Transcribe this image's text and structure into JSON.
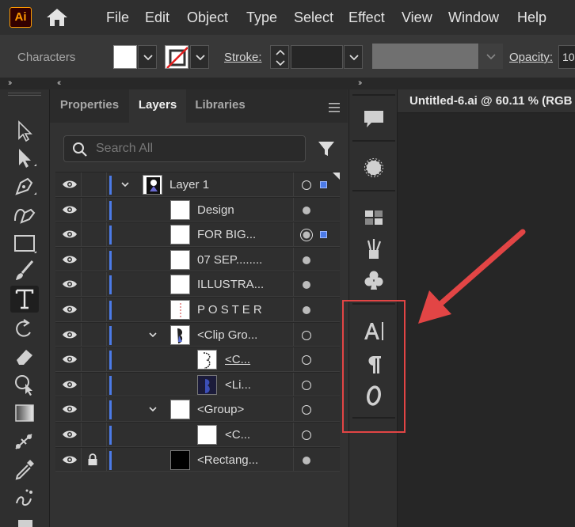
{
  "app": {
    "logo": "Ai"
  },
  "menu": [
    "File",
    "Edit",
    "Object",
    "Type",
    "Select",
    "Effect",
    "View",
    "Window",
    "Help"
  ],
  "control_bar": {
    "context_label": "Characters",
    "stroke_label": "Stroke:",
    "opacity_label": "Opacity:",
    "opacity_value": "10"
  },
  "panel": {
    "tabs": [
      "Properties",
      "Layers",
      "Libraries"
    ],
    "active_tab": "Layers",
    "search_placeholder": "Search All"
  },
  "layers": [
    {
      "name": "Layer 1",
      "underline": false
    },
    {
      "name": "Design",
      "underline": false
    },
    {
      "name": "FOR BIG...",
      "underline": false
    },
    {
      "name": "07 SEP........",
      "underline": false
    },
    {
      "name": "ILLUSTRA...",
      "underline": false
    },
    {
      "name": "P O S T E R",
      "underline": false
    },
    {
      "name": "<Clip Gro...",
      "underline": false
    },
    {
      "name": "<C...",
      "underline": true
    },
    {
      "name": "<Li...",
      "underline": false
    },
    {
      "name": "<Group>",
      "underline": false
    },
    {
      "name": "<C...",
      "underline": false
    },
    {
      "name": "<Rectang...",
      "underline": false
    }
  ],
  "document": {
    "tab_title": "Untitled-6.ai @ 60.11 % (RGB"
  },
  "colors": {
    "layer_color": "#4c7be8",
    "highlight": "#e24545",
    "logo_fg": "#ff9a00"
  }
}
